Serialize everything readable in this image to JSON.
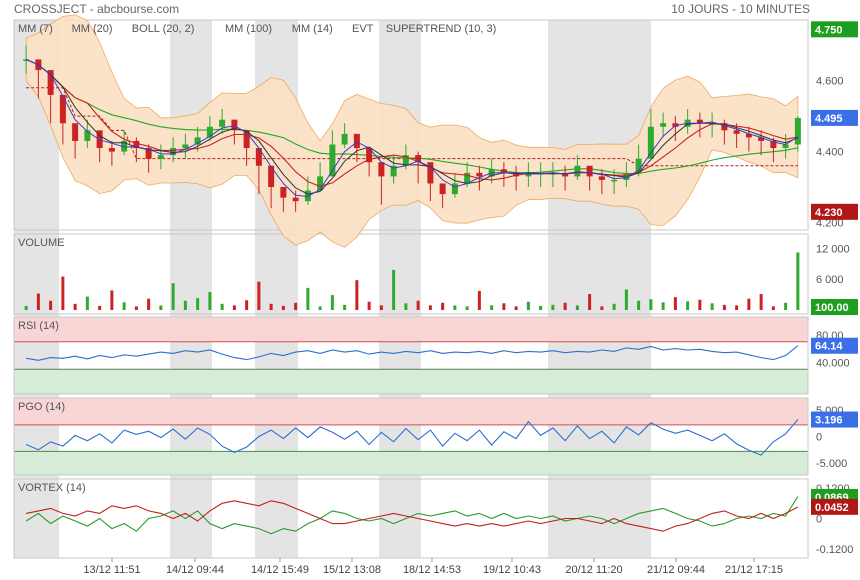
{
  "header": {
    "symbol_source": "CROSSJECT - abcbourse.com",
    "period": "10 JOURS - 10 MINUTES"
  },
  "price_legend": [
    {
      "label": "MM (7)",
      "color": "#3b3bd0"
    },
    {
      "label": "MM (20)",
      "color": "#d02020"
    },
    {
      "label": "BOLL (20, 2)",
      "color": "#f0a050"
    },
    {
      "label": "MM (100)",
      "color": "#22aa22"
    },
    {
      "label": "MM (14)",
      "color": "#333333"
    },
    {
      "label": "EVT",
      "color": "#333333"
    },
    {
      "label": "SUPERTREND (10, 3)",
      "color": "#b02020"
    }
  ],
  "panels": {
    "volume": {
      "label": "VOLUME"
    },
    "rsi": {
      "label": "RSI (14)"
    },
    "pgo": {
      "label": "PGO (14)"
    },
    "vortex": {
      "label": "VORTEX (14)"
    }
  },
  "badges": {
    "price_high": "4.750",
    "price_last": "4.495",
    "price_low": "4.230",
    "volume_last": "100.00",
    "rsi_last": "64.14",
    "pgo_last": "3.196",
    "vortex_plus": "0.0869",
    "vortex_minus": "0.0452"
  },
  "colors": {
    "green_badge": "#1e9e1e",
    "blue_badge": "#3a6fe8",
    "red_badge": "#b01818",
    "up_candle": "#2eaa2e",
    "down_candle": "#cc2222",
    "shade": "#e4e4e4",
    "zone_red": "#f9d6d6",
    "zone_green": "#d6ecd6",
    "indicator_line": "#2c6fd1",
    "bollinger_fill": "#fbe1c4"
  },
  "chart_data": [
    {
      "type": "candlestick",
      "name": "price",
      "yticks": [
        "4.600",
        "4.400",
        "4.200"
      ],
      "ylim": [
        4.19,
        4.76
      ],
      "x": [
        "13/12 11:51",
        "14/12 09:44",
        "14/12 15:49",
        "15/12 13:08",
        "18/12 14:53",
        "19/12 10:43",
        "20/12 11:20",
        "21/12 09:44",
        "21/12 17:15"
      ],
      "close": [
        4.66,
        4.63,
        4.56,
        4.48,
        4.43,
        4.46,
        4.41,
        4.4,
        4.43,
        4.41,
        4.38,
        4.39,
        4.41,
        4.42,
        4.44,
        4.47,
        4.49,
        4.46,
        4.41,
        4.36,
        4.3,
        4.27,
        4.26,
        4.29,
        4.33,
        4.42,
        4.45,
        4.41,
        4.37,
        4.33,
        4.36,
        4.39,
        4.37,
        4.31,
        4.28,
        4.31,
        4.34,
        4.33,
        4.35,
        4.34,
        4.33,
        4.34,
        4.34,
        4.34,
        4.33,
        4.36,
        4.33,
        4.32,
        4.32,
        4.34,
        4.38,
        4.47,
        4.48,
        4.47,
        4.49,
        4.48,
        4.48,
        4.46,
        4.45,
        4.44,
        4.43,
        4.41,
        4.42,
        4.495
      ],
      "high": [
        4.7,
        4.66,
        4.6,
        4.52,
        4.47,
        4.49,
        4.44,
        4.43,
        4.46,
        4.44,
        4.42,
        4.42,
        4.44,
        4.45,
        4.47,
        4.5,
        4.52,
        4.49,
        4.45,
        4.4,
        4.34,
        4.3,
        4.29,
        4.33,
        4.37,
        4.46,
        4.48,
        4.44,
        4.4,
        4.36,
        4.39,
        4.42,
        4.4,
        4.34,
        4.31,
        4.34,
        4.37,
        4.36,
        4.38,
        4.37,
        4.36,
        4.37,
        4.37,
        4.37,
        4.36,
        4.39,
        4.36,
        4.35,
        4.35,
        4.37,
        4.42,
        4.52,
        4.51,
        4.5,
        4.52,
        4.51,
        4.51,
        4.49,
        4.48,
        4.47,
        4.46,
        4.44,
        4.45,
        4.5
      ],
      "low": [
        4.62,
        4.55,
        4.48,
        4.42,
        4.38,
        4.41,
        4.37,
        4.36,
        4.39,
        4.37,
        4.34,
        4.35,
        4.37,
        4.38,
        4.4,
        4.43,
        4.45,
        4.42,
        4.36,
        4.28,
        4.24,
        4.23,
        4.23,
        4.25,
        4.29,
        4.37,
        4.41,
        4.37,
        4.33,
        4.25,
        4.31,
        4.35,
        4.31,
        4.26,
        4.24,
        4.27,
        4.3,
        4.29,
        4.31,
        4.3,
        4.29,
        4.3,
        4.3,
        4.3,
        4.29,
        4.32,
        4.29,
        4.28,
        4.28,
        4.3,
        4.33,
        4.42,
        4.44,
        4.43,
        4.45,
        4.44,
        4.44,
        4.42,
        4.41,
        4.4,
        4.39,
        4.37,
        4.38,
        4.4
      ]
    },
    {
      "type": "bar",
      "name": "volume",
      "yticks": [
        "12 000",
        "6 000"
      ],
      "ylim": [
        0,
        14000
      ],
      "values": [
        800,
        3200,
        1800,
        6500,
        1200,
        2600,
        800,
        3800,
        1500,
        700,
        2200,
        900,
        5200,
        1800,
        2300,
        3500,
        1200,
        900,
        1900,
        5500,
        1200,
        800,
        1400,
        4300,
        700,
        2900,
        1000,
        5800,
        1600,
        900,
        7800,
        1300,
        1800,
        900,
        1400,
        900,
        700,
        3700,
        900,
        1300,
        700,
        1600,
        800,
        1000,
        1400,
        900,
        3100,
        700,
        1200,
        4000,
        1800,
        2100,
        1500,
        2500,
        1700,
        2000,
        1300,
        1000,
        900,
        2200,
        3100,
        700,
        1400,
        11200
      ]
    },
    {
      "type": "line",
      "name": "rsi",
      "yticks": [
        "80.00",
        "40.000"
      ],
      "ylim": [
        0,
        100
      ],
      "zones": [
        70,
        30
      ],
      "values": [
        46,
        43,
        47,
        46,
        49,
        45,
        50,
        47,
        51,
        49,
        52,
        55,
        53,
        57,
        55,
        58,
        52,
        47,
        44,
        48,
        53,
        50,
        55,
        57,
        53,
        58,
        55,
        57,
        52,
        55,
        53,
        56,
        54,
        57,
        53,
        55,
        54,
        56,
        53,
        57,
        54,
        56,
        55,
        57,
        54,
        56,
        55,
        58,
        56,
        61,
        59,
        63,
        58,
        60,
        58,
        59,
        56,
        54,
        55,
        51,
        47,
        44,
        50,
        64.14
      ]
    },
    {
      "type": "line",
      "name": "pgo",
      "yticks": [
        "5.000",
        "0",
        "-5.000"
      ],
      "ylim": [
        -6.5,
        6.5
      ],
      "zones": [
        2.2,
        -2.8
      ],
      "values": [
        -1.5,
        -2.5,
        -1.0,
        -1.8,
        0.2,
        -0.8,
        0.5,
        -1.2,
        1.2,
        0.4,
        1.0,
        -0.2,
        1.4,
        -0.5,
        1.6,
        0.4,
        -1.8,
        -3.0,
        -2.0,
        0.0,
        1.2,
        -0.4,
        1.6,
        -0.2,
        1.8,
        0.8,
        -0.5,
        1.0,
        -1.5,
        0.8,
        -1.0,
        1.5,
        -0.6,
        1.2,
        -1.8,
        0.6,
        -0.8,
        1.2,
        -1.6,
        0.9,
        -0.4,
        2.8,
        0.2,
        1.6,
        -0.8,
        2.0,
        -0.4,
        1.0,
        -1.2,
        1.8,
        0.3,
        2.6,
        1.4,
        0.6,
        1.2,
        0.2,
        -0.8,
        0.5,
        -1.4,
        -2.6,
        -3.5,
        -1.0,
        0.5,
        3.196
      ]
    },
    {
      "type": "line",
      "name": "vortex",
      "yticks": [
        "0.1200",
        "0",
        "-0.1200"
      ],
      "ylim": [
        -0.14,
        0.14
      ],
      "series": [
        {
          "name": "VI+",
          "values": [
            -0.01,
            0.02,
            -0.02,
            0.01,
            -0.01,
            -0.03,
            0.0,
            -0.04,
            -0.02,
            -0.05,
            0.0,
            0.01,
            0.03,
            0.0,
            0.03,
            -0.02,
            -0.04,
            -0.02,
            -0.03,
            -0.04,
            -0.06,
            -0.04,
            -0.05,
            -0.02,
            0.0,
            0.03,
            0.02,
            0.0,
            -0.01,
            0.0,
            -0.02,
            0.0,
            0.02,
            0.01,
            0.02,
            0.03,
            0.01,
            0.02,
            0.0,
            0.02,
            0.0,
            0.01,
            0.0,
            0.01,
            -0.01,
            0.0,
            0.01,
            0.0,
            -0.02,
            0.0,
            0.02,
            0.03,
            0.04,
            0.02,
            0.0,
            -0.01,
            -0.03,
            -0.02,
            0.0,
            0.01,
            0.0,
            0.02,
            0.01,
            0.0869
          ]
        },
        {
          "name": "VI-",
          "values": [
            0.02,
            0.03,
            0.04,
            0.02,
            0.01,
            0.03,
            0.02,
            0.05,
            0.04,
            0.05,
            0.03,
            0.02,
            0.0,
            0.02,
            -0.01,
            0.03,
            0.06,
            0.07,
            0.06,
            0.05,
            0.07,
            0.06,
            0.04,
            0.02,
            0.0,
            -0.02,
            -0.02,
            -0.01,
            0.0,
            0.01,
            0.02,
            0.01,
            0.0,
            -0.01,
            -0.02,
            -0.03,
            -0.02,
            -0.03,
            -0.02,
            -0.03,
            -0.02,
            -0.01,
            -0.02,
            -0.01,
            0.0,
            0.0,
            -0.01,
            -0.02,
            0.0,
            -0.02,
            -0.03,
            -0.04,
            -0.05,
            -0.03,
            -0.02,
            0.0,
            0.02,
            0.03,
            0.01,
            0.0,
            0.02,
            0.0,
            0.02,
            0.0452
          ]
        }
      ]
    }
  ]
}
